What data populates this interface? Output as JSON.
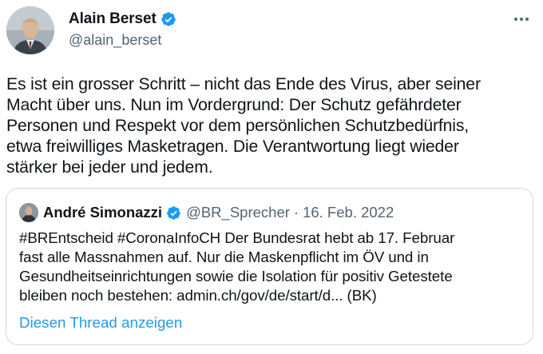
{
  "author": {
    "display_name": "Alain Berset",
    "handle": "@alain_berset"
  },
  "tweet": {
    "text": "Es ist ein grosser Schritt – nicht das Ende des Virus, aber seiner\nMacht über uns. Nun im Vordergrund: Der Schutz gefährdeter\nPersonen und Respekt vor dem persönlichen Schutzbedürfnis,\netwa freiwilliges Masketragen. Die Verantwortung liegt wieder\nstärker bei jeder und jedem."
  },
  "quoted_tweet": {
    "display_name": "André Simonazzi",
    "handle": "@BR_Sprecher",
    "separator": "·",
    "date": "16. Feb. 2022",
    "text": "#BREntscheid #CoronaInfoCH Der Bundesrat hebt ab 17. Februar\nfast alle Massnahmen auf. Nur die Maskenpflicht im ÖV und in\nGesundheitseinrichtungen sowie die Isolation für positiv Getestete\nbleiben noch bestehen: admin.ch/gov/de/start/d... (BK)",
    "show_thread_label": "Diesen Thread anzeigen"
  },
  "icons": {
    "verified": "verified-badge-icon",
    "more": "more-options-icon"
  },
  "colors": {
    "verified": "#1d9bf0",
    "link": "#1d9bf0",
    "secondary_text": "#536471",
    "border": "#cfd9de"
  }
}
